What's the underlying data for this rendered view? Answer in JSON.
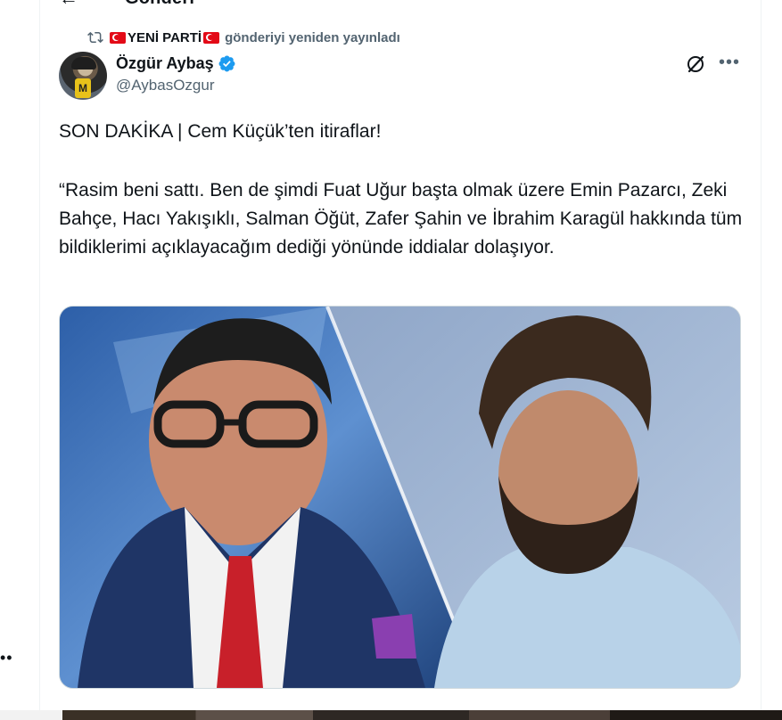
{
  "header": {
    "title": "Gönderi",
    "back_icon": "arrow-left-icon"
  },
  "repost": {
    "icon": "repost-icon",
    "account_name": "YENİ PARTİ",
    "flag_icon": "turkey-flag-icon",
    "text": "gönderiyi yeniden yayınladı"
  },
  "tweet": {
    "author": {
      "display_name": "Özgür Aybaş",
      "handle": "@AybasOzgur",
      "verified": true,
      "verified_color": "#1d9bf0"
    },
    "headline": "SON DAKİKA | Cem Küçük’ten itiraflar!",
    "body": "“Rasim beni sattı. Ben de şimdi Fuat Uğur başta olmak üzere Emin Pazarcı, Zeki Bahçe, Hacı Yakışıklı, Salman Öğüt, Zafer Şahin ve İbrahim Karagül hakkında tüm bildiklerimi açıklayacağım dediği yönünde iddialar dolaşıyor.",
    "actions": {
      "grok_icon": "grok-icon",
      "more_icon": "more-options-icon"
    },
    "media": {
      "description_icon": "photo-collage-two-men"
    }
  },
  "side": {
    "dots": "••"
  },
  "colors": {
    "text_primary": "#0f1419",
    "text_secondary": "#536471",
    "accent": "#1d9bf0",
    "flag_red": "#e30a17"
  }
}
